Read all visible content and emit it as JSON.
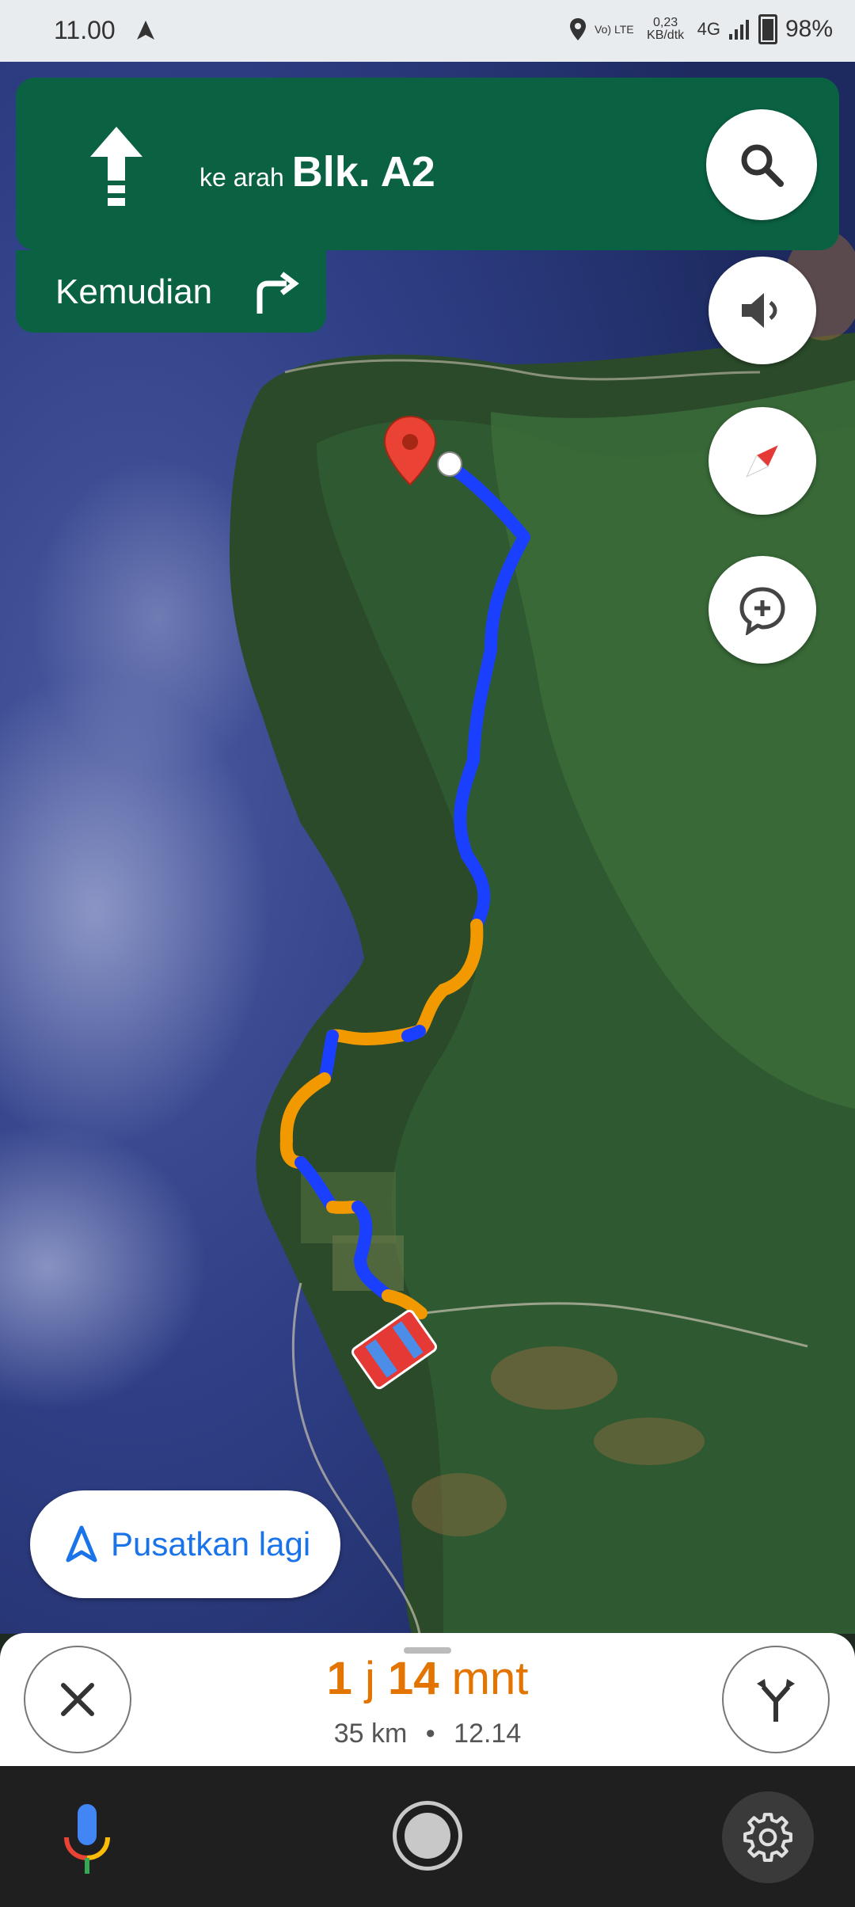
{
  "status_bar": {
    "time": "11.00",
    "network_speed": "0,23 KB/dtk",
    "volte": "Vo) LTE",
    "network_type": "4G",
    "battery": "98%"
  },
  "navigation": {
    "toward_prefix": "ke arah",
    "street": "Blk. A2",
    "then_label": "Kemudian",
    "then_maneuver": "turn-right-icon"
  },
  "map": {
    "route_colors": {
      "clear": "#1a3fff",
      "slow": "#f29900"
    },
    "destination_marker_color": "#ea4335"
  },
  "controls": {
    "search": "search-icon",
    "sound": "volume-icon",
    "compass": "compass-icon",
    "report": "add-report-icon"
  },
  "recenter_label": "Pusatkan lagi",
  "eta": {
    "hours": "1",
    "hours_unit": "j",
    "minutes": "14",
    "minutes_unit": "mnt",
    "distance": "35 km",
    "separator": "•",
    "arrival_time": "12.14"
  },
  "colors": {
    "nav_green": "#0b6243",
    "eta_orange": "#e37400",
    "link_blue": "#1a73e8"
  }
}
